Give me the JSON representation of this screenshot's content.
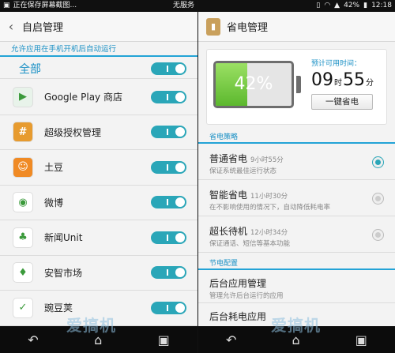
{
  "left": {
    "status": {
      "text": "正在保存屏幕截图...",
      "carrier": "无服务"
    },
    "title": "自启管理",
    "hint": "允许应用在手机开机后自动运行",
    "all_label": "全部",
    "apps": [
      {
        "name": "Google Play 商店",
        "icon": "google-play-icon",
        "color": "#e8f3ea",
        "glyph": "▶"
      },
      {
        "name": "超级授权管理",
        "icon": "superuser-icon",
        "color": "#e79b2f",
        "glyph": "#"
      },
      {
        "name": "土豆",
        "icon": "tudou-icon",
        "color": "#f08a24",
        "glyph": "☺"
      },
      {
        "name": "微博",
        "icon": "weibo-icon",
        "color": "#ffffff",
        "glyph": "◉"
      },
      {
        "name": "新闻Unit",
        "icon": "android-icon",
        "color": "#ffffff",
        "glyph": "♣"
      },
      {
        "name": "安智市场",
        "icon": "anzhi-icon",
        "color": "#ffffff",
        "glyph": "♦"
      },
      {
        "name": "豌豆荚",
        "icon": "wandoujia-icon",
        "color": "#ffffff",
        "glyph": "✓"
      }
    ],
    "accent": "#2aa6b8"
  },
  "right": {
    "status": {
      "battery": "42%",
      "time": "12:18"
    },
    "title": "省电管理",
    "battery_percent": 42,
    "battery_label": "42%",
    "pred_label": "预计可用时间：",
    "pred_hours": "09",
    "pred_h_unit": "时",
    "pred_minutes": "55",
    "pred_m_unit": "分",
    "onekey_label": "一键省电",
    "strategy_header": "省电策略",
    "modes": [
      {
        "name": "普通省电",
        "time": "9小时55分",
        "desc": "保证系统最佳运行状态",
        "selected": true
      },
      {
        "name": "智能省电",
        "time": "11小时30分",
        "desc": "在不影响使用的情况下，自动降低耗电率",
        "selected": false
      },
      {
        "name": "超长待机",
        "time": "12小时34分",
        "desc": "保证通话、短信等基本功能",
        "selected": false
      }
    ],
    "config_header": "节电配置",
    "configs": [
      {
        "name": "后台应用管理",
        "desc": "管理允许后台运行的应用"
      },
      {
        "name": "后台耗电应用",
        "desc": ""
      }
    ]
  },
  "watermark": "爱搞机"
}
